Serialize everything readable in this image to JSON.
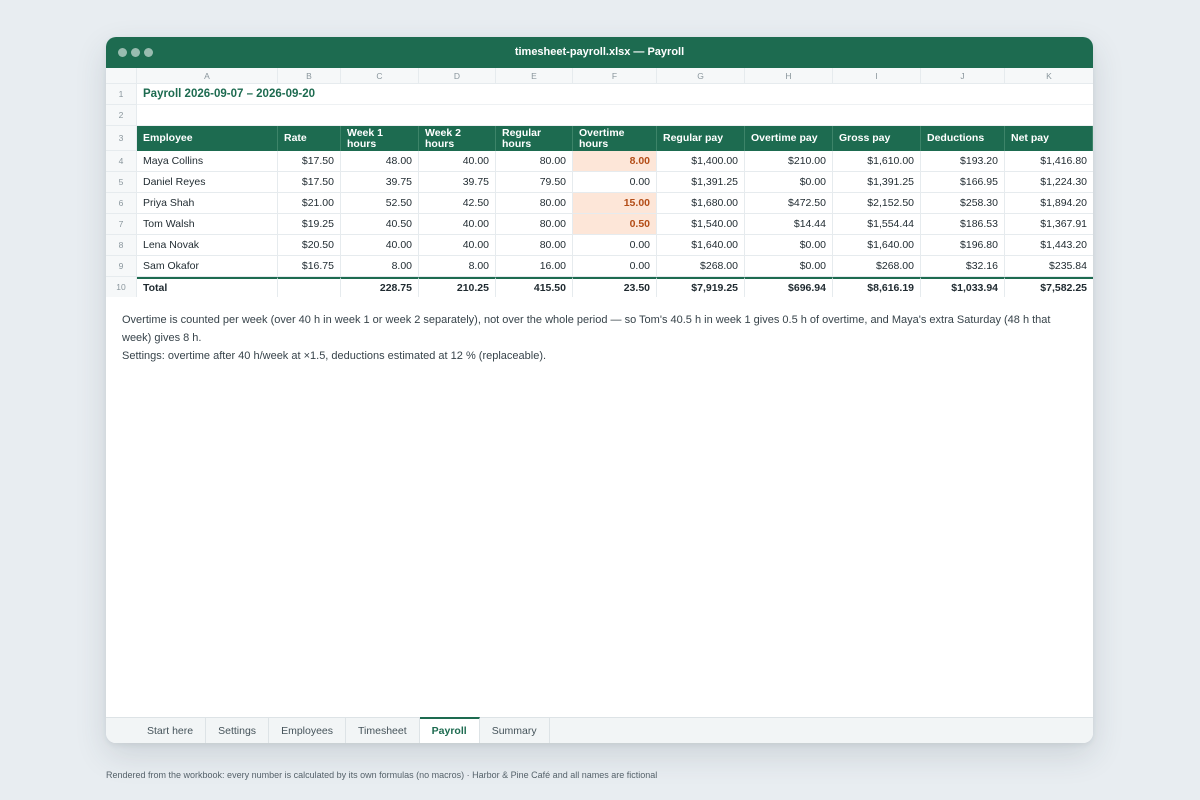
{
  "window": {
    "title": "timesheet-payroll.xlsx — Payroll"
  },
  "column_letters": [
    "A",
    "B",
    "C",
    "D",
    "E",
    "F",
    "G",
    "H",
    "I",
    "J",
    "K"
  ],
  "row_numbers": [
    "1",
    "2",
    "3",
    "4",
    "5",
    "6",
    "7",
    "8",
    "9",
    "10"
  ],
  "sheet": {
    "title": "Payroll 2026-09-07 – 2026-09-20",
    "headers": [
      "Employee",
      "Rate",
      "Week 1 hours",
      "Week 2 hours",
      "Regular hours",
      "Overtime hours",
      "Regular pay",
      "Overtime pay",
      "Gross pay",
      "Deductions",
      "Net pay"
    ],
    "rows": [
      [
        "Maya Collins",
        "$17.50",
        "48.00",
        "40.00",
        "80.00",
        "8.00",
        "$1,400.00",
        "$210.00",
        "$1,610.00",
        "$193.20",
        "$1,416.80"
      ],
      [
        "Daniel Reyes",
        "$17.50",
        "39.75",
        "39.75",
        "79.50",
        "0.00",
        "$1,391.25",
        "$0.00",
        "$1,391.25",
        "$166.95",
        "$1,224.30"
      ],
      [
        "Priya Shah",
        "$21.00",
        "52.50",
        "42.50",
        "80.00",
        "15.00",
        "$1,680.00",
        "$472.50",
        "$2,152.50",
        "$258.30",
        "$1,894.20"
      ],
      [
        "Tom Walsh",
        "$19.25",
        "40.50",
        "40.00",
        "80.00",
        "0.50",
        "$1,540.00",
        "$14.44",
        "$1,554.44",
        "$186.53",
        "$1,367.91"
      ],
      [
        "Lena Novak",
        "$20.50",
        "40.00",
        "40.00",
        "80.00",
        "0.00",
        "$1,640.00",
        "$0.00",
        "$1,640.00",
        "$196.80",
        "$1,443.20"
      ],
      [
        "Sam Okafor",
        "$16.75",
        "8.00",
        "8.00",
        "16.00",
        "0.00",
        "$268.00",
        "$0.00",
        "$268.00",
        "$32.16",
        "$235.84"
      ]
    ],
    "total": [
      "Total",
      "",
      "228.75",
      "210.25",
      "415.50",
      "23.50",
      "$7,919.25",
      "$696.94",
      "$8,616.19",
      "$1,033.94",
      "$7,582.25"
    ]
  },
  "notes": [
    "Overtime is counted per week (over 40 h in week 1 or week 2 separately), not over the whole period — so Tom's 40.5 h in week 1 gives 0.5 h of overtime, and Maya's extra Saturday (48 h that week) gives 8 h.",
    "Settings: overtime after 40 h/week at ×1.5, deductions estimated at 12 % (replaceable)."
  ],
  "tabs": [
    "Start here",
    "Settings",
    "Employees",
    "Timesheet",
    "Payroll",
    "Summary"
  ],
  "active_tab": "Payroll",
  "footer": "Rendered from the workbook: every number is calculated by its own formulas (no macros) · Harbor & Pine Café and all names are fictional",
  "colors": {
    "accent": "#1d6b50",
    "overtime_highlight": "#fde6d8",
    "overtime_text": "#b34d17"
  }
}
